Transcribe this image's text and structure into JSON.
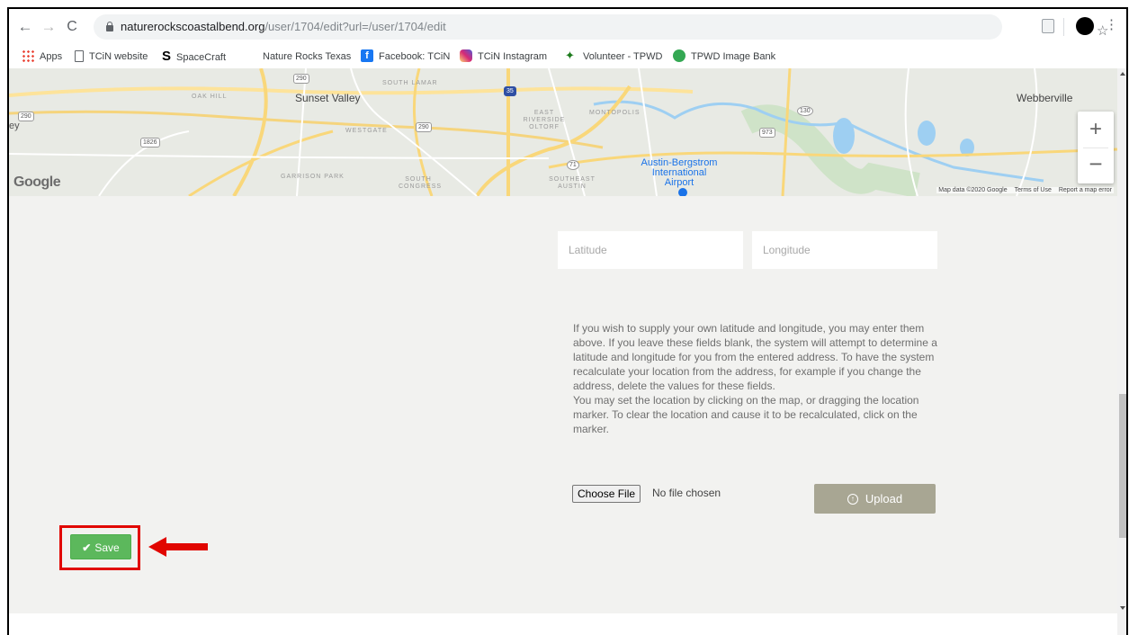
{
  "browser": {
    "url_host": "naturerockscoastalbend.org",
    "url_path": "/user/1704/edit?url=/user/1704/edit",
    "back": "←",
    "forward": "→",
    "reload": "C",
    "star": "☆",
    "menu": "⋮"
  },
  "bookmarks": [
    {
      "label": "Apps"
    },
    {
      "label": "TCiN website"
    },
    {
      "label": "SpaceCraft"
    },
    {
      "label": "Nature Rocks Texas"
    },
    {
      "label": "Facebook: TCiN"
    },
    {
      "label": "TCiN Instagram"
    },
    {
      "label": "Volunteer - TPWD"
    },
    {
      "label": "TPWD Image Bank"
    }
  ],
  "map": {
    "labels": {
      "sunset_valley": "Sunset Valley",
      "webberville": "Webberville",
      "airport": "Austin-Bergstrom International Airport",
      "oak_hill": "OAK HILL",
      "westgate": "WESTGATE",
      "south_lamar": "SOUTH LAMAR",
      "east_riverside": "EAST RIVERSIDE OLTORF",
      "montopolis": "MONTOPOLIS",
      "garrison_park": "GARRISON PARK",
      "south_congress": "SOUTH CONGRESS",
      "southeast_austin": "SOUTHEAST AUSTIN",
      "ey": "ey"
    },
    "shields": [
      "290",
      "290",
      "290",
      "1826",
      "71",
      "130",
      "973",
      "35"
    ],
    "google": "Google",
    "attribution": "Map data ©2020 Google",
    "terms": "Terms of Use",
    "report": "Report a map error",
    "zoom_in": "+",
    "zoom_out": "−"
  },
  "form": {
    "latitude_placeholder": "Latitude",
    "longitude_placeholder": "Longitude",
    "help_paragraph_1": "If you wish to supply your own latitude and longitude, you may enter them above. If you leave these fields blank, the system will attempt to determine a latitude and longitude for you from the entered address. To have the system recalculate your location from the address, for example if you change the address, delete the values for these fields.",
    "help_paragraph_2": "You may set the location by clicking on the map, or dragging the location marker. To clear the location and cause it to be recalculated, click on the marker.",
    "choose_file_label": "Choose File",
    "no_file_text": "No file chosen",
    "upload_label": "Upload",
    "save_label": "Save"
  },
  "colors": {
    "save_green": "#5cb85c",
    "upload_olive": "#a8a693",
    "highlight_red": "#e10600"
  }
}
